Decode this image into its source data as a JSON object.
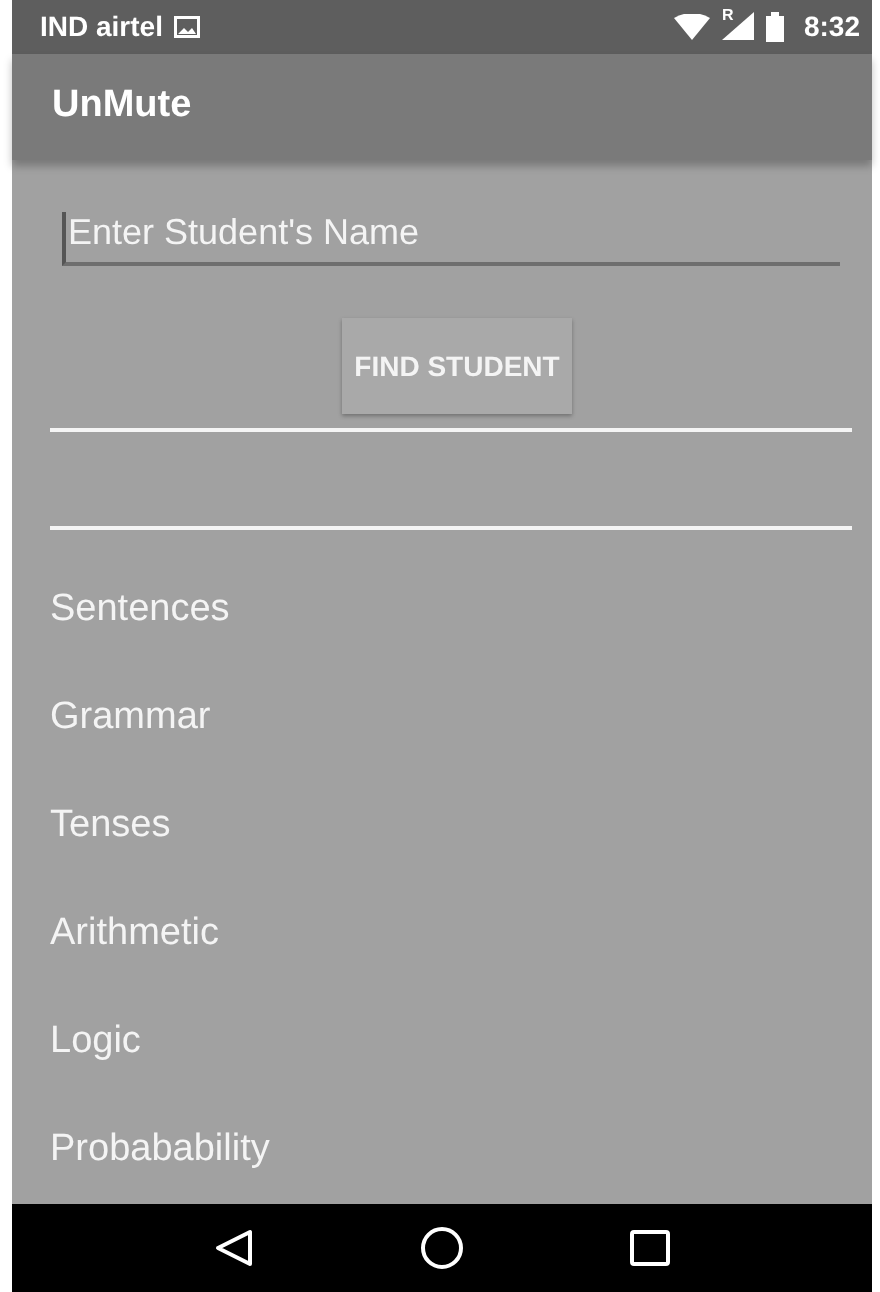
{
  "status_bar": {
    "carrier": "IND airtel",
    "roaming_mark": "R",
    "time": "8:32"
  },
  "app_bar": {
    "title": "UnMute"
  },
  "search": {
    "placeholder": "Enter Student's Name"
  },
  "find_button": {
    "label": "FIND STUDENT"
  },
  "topics": [
    {
      "label": "Sentences"
    },
    {
      "label": "Grammar"
    },
    {
      "label": "Tenses"
    },
    {
      "label": "Arithmetic"
    },
    {
      "label": "Logic"
    },
    {
      "label": "Probabability"
    }
  ]
}
